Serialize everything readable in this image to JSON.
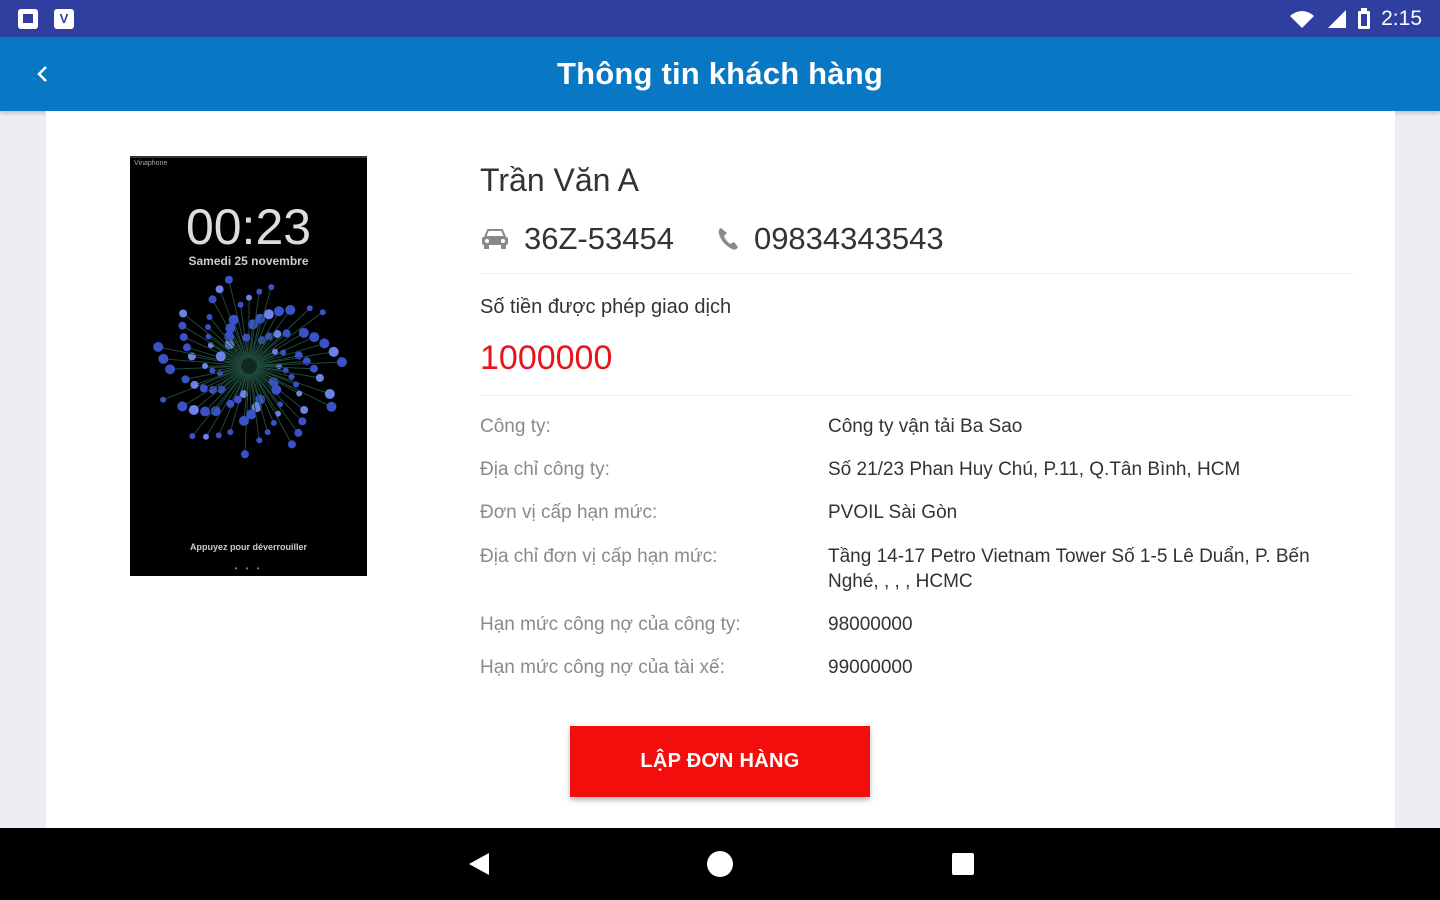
{
  "status_bar": {
    "notifications": [
      "message-icon",
      "app-v-icon"
    ],
    "notif_glyph": "V",
    "time": "2:15"
  },
  "app_bar": {
    "title": "Thông tin khách hàng"
  },
  "photo": {
    "carrier": "Vinaphone",
    "clock": "00:23",
    "date": "Samedi 25 novembre",
    "unlock_hint": "Appuyez pour déverrouiller",
    "pager": "• • •"
  },
  "customer": {
    "name": "Trần Văn A",
    "plate": "36Z-53454",
    "phone": "09834343543"
  },
  "transaction_limit": {
    "label": "Số tiền được phép giao dịch",
    "value": "1000000"
  },
  "details": [
    {
      "label": "Công ty:",
      "value": "Công ty vận tải Ba Sao"
    },
    {
      "label": "Địa chỉ công ty:",
      "value": "Số 21/23 Phan Huy Chú, P.11, Q.Tân Bình, HCM"
    },
    {
      "label": "Đơn vị cấp hạn mức:",
      "value": "PVOIL Sài Gòn"
    },
    {
      "label": "Địa chỉ đơn vị cấp hạn mức:",
      "value": "Tầng 14-17 Petro Vietnam Tower Số 1-5 Lê Duẩn, P. Bến Nghé, , , , HCMC"
    },
    {
      "label": "Hạn mức công nợ của công ty:",
      "value": "98000000"
    },
    {
      "label": "Hạn mức công nợ của tài xế:",
      "value": "99000000"
    }
  ],
  "actions": {
    "create_order": "LẬP ĐƠN HÀNG"
  },
  "colors": {
    "status_bar": "#303f9f",
    "app_bar": "#0877c4",
    "accent_red": "#f40d0d",
    "limit_value": "#e8141d"
  }
}
